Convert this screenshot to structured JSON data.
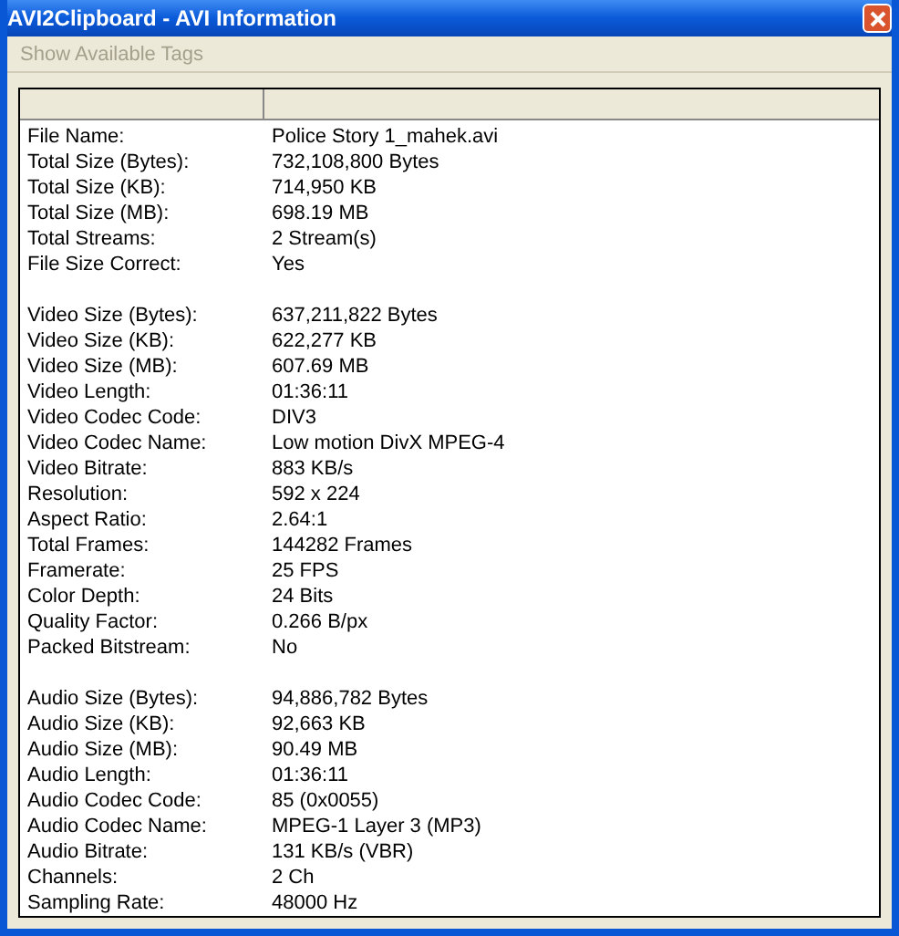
{
  "window": {
    "title": "AVI2Clipboard - AVI Information"
  },
  "menu": [
    {
      "label": "Show Available Tags",
      "disabled": true
    }
  ],
  "sections": [
    {
      "rows": [
        {
          "label": "File Name:",
          "value": "Police Story 1_mahek.avi"
        },
        {
          "label": "Total Size (Bytes):",
          "value": "732,108,800 Bytes"
        },
        {
          "label": "Total Size (KB):",
          "value": "714,950 KB"
        },
        {
          "label": "Total Size (MB):",
          "value": "698.19 MB"
        },
        {
          "label": "Total Streams:",
          "value": "2 Stream(s)"
        },
        {
          "label": "File Size Correct:",
          "value": "Yes"
        }
      ]
    },
    {
      "rows": [
        {
          "label": "Video Size (Bytes):",
          "value": "637,211,822 Bytes"
        },
        {
          "label": "Video Size (KB):",
          "value": "622,277 KB"
        },
        {
          "label": "Video Size (MB):",
          "value": "607.69 MB"
        },
        {
          "label": "Video Length:",
          "value": "01:36:11"
        },
        {
          "label": "Video Codec Code:",
          "value": "DIV3"
        },
        {
          "label": "Video Codec Name:",
          "value": "Low motion DivX MPEG-4"
        },
        {
          "label": "Video Bitrate:",
          "value": "883 KB/s"
        },
        {
          "label": "Resolution:",
          "value": "592 x 224"
        },
        {
          "label": "Aspect Ratio:",
          "value": "2.64:1"
        },
        {
          "label": "Total Frames:",
          "value": "144282 Frames"
        },
        {
          "label": "Framerate:",
          "value": "25 FPS"
        },
        {
          "label": "Color Depth:",
          "value": "24 Bits"
        },
        {
          "label": "Quality Factor:",
          "value": "0.266 B/px"
        },
        {
          "label": "Packed Bitstream:",
          "value": "No"
        }
      ]
    },
    {
      "rows": [
        {
          "label": "Audio Size (Bytes):",
          "value": "94,886,782 Bytes"
        },
        {
          "label": "Audio Size (KB):",
          "value": "92,663 KB"
        },
        {
          "label": "Audio Size (MB):",
          "value": "90.49 MB"
        },
        {
          "label": "Audio Length:",
          "value": "01:36:11"
        },
        {
          "label": "Audio Codec Code:",
          "value": "85 (0x0055)"
        },
        {
          "label": "Audio Codec Name:",
          "value": "MPEG-1 Layer 3 (MP3)"
        },
        {
          "label": "Audio Bitrate:",
          "value": "131 KB/s (VBR)"
        },
        {
          "label": "Channels:",
          "value": "2 Ch"
        },
        {
          "label": "Sampling Rate:",
          "value": "48000 Hz"
        }
      ]
    }
  ]
}
